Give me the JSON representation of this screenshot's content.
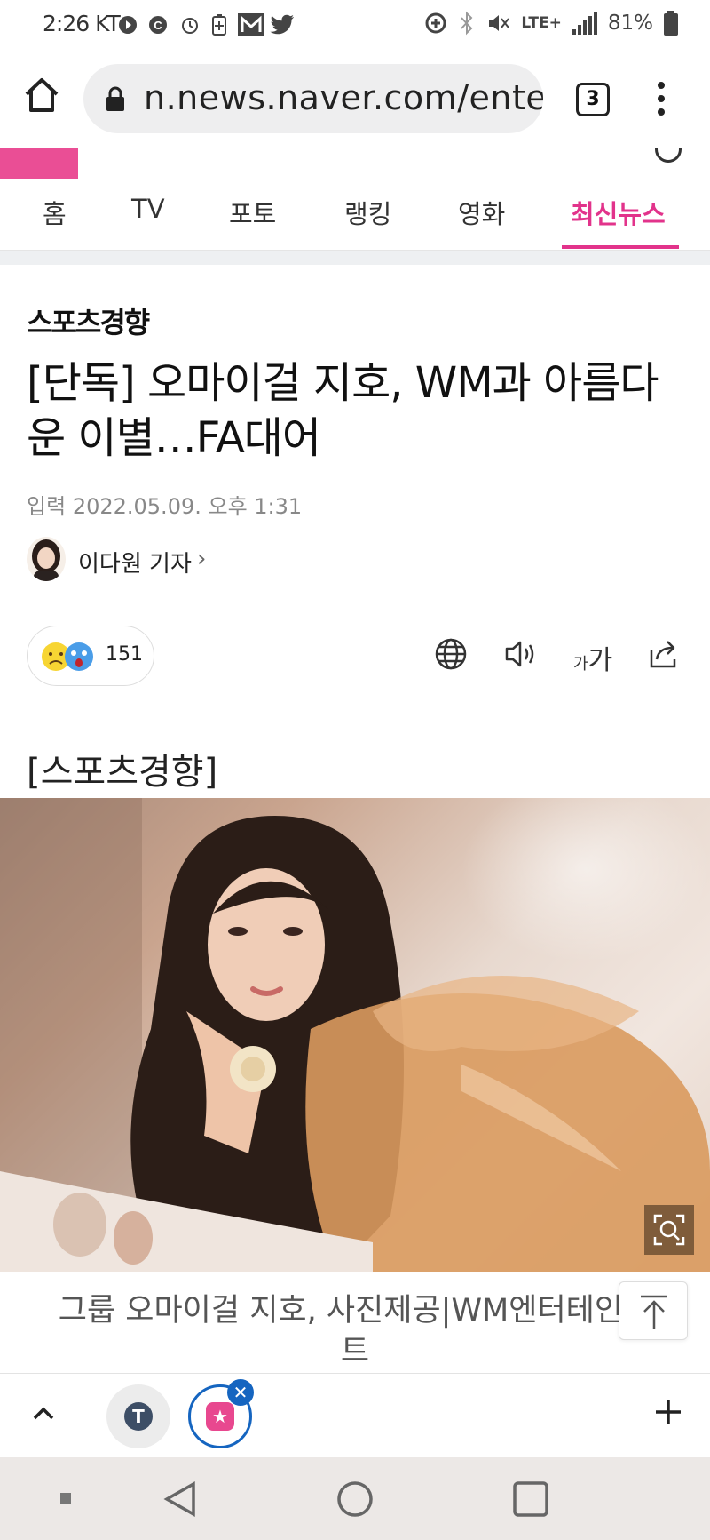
{
  "status_bar": {
    "time": "2:26",
    "carrier": "KT",
    "network": "LTE+",
    "battery": "81%"
  },
  "browser": {
    "url": "n.news.naver.com/entert",
    "tabs_count": "3"
  },
  "nav": {
    "items": [
      {
        "label": "홈"
      },
      {
        "label": "TV"
      },
      {
        "label": "포토"
      },
      {
        "label": "랭킹"
      },
      {
        "label": "영화"
      },
      {
        "label": "최신뉴스"
      }
    ],
    "active": "최신뉴스"
  },
  "article": {
    "press": "스포츠경향",
    "title": "[단독] 오마이걸 지호, WM과 아름다운 이별…FA대어",
    "date_label": "입력",
    "date": "2022.05.09. 오후 1:31",
    "reporter": "이다원 기자",
    "reaction_count": "151",
    "font_size_label": "가가",
    "caption_head": "[스포츠경향]",
    "photo_caption": "그룹 오마이걸 지호, 사진제공|WM엔터테인먼트"
  },
  "colors": {
    "accent": "#e2338b",
    "tab_highlight": "#1565c0",
    "nav_bg": "#ece8e6"
  }
}
